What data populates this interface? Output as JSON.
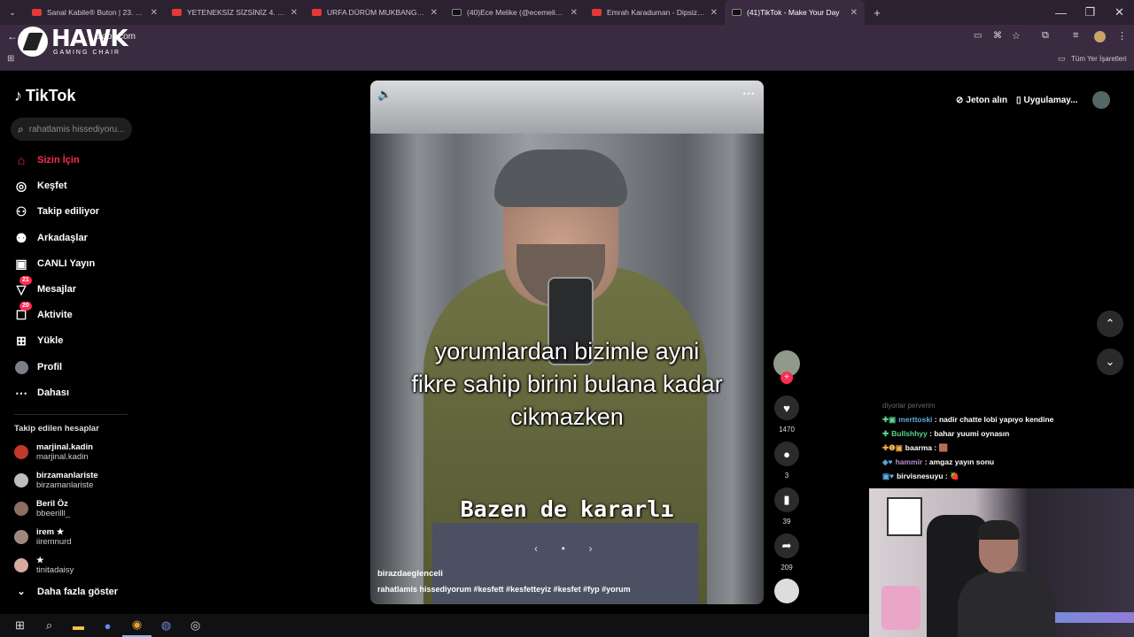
{
  "browser": {
    "tabs": [
      {
        "title": "Sanal Kabile® Buton | 23. Bölüm",
        "icon": "youtube-icon"
      },
      {
        "title": "YETENEKSİZ SİZSİNİZ 4. BÖLÜM",
        "icon": "youtube-icon"
      },
      {
        "title": "URFA DÜRÜM MUKBANG İLİŞK",
        "icon": "youtube-icon"
      },
      {
        "title": "(40)Ece Melike (@ecemelikec) |",
        "icon": "tiktok-icon"
      },
      {
        "title": "Emrah Karaduman - Dipsiz Kuyu",
        "icon": "youtube-icon"
      },
      {
        "title": "(41)TikTok - Make Your Day",
        "icon": "tiktok-icon"
      }
    ],
    "url": "tiktok.com",
    "bookmarks_label": "Tüm Yer İşaretleri"
  },
  "overlay_logo": {
    "word": "HAWK",
    "sub": "GAMING CHAIR"
  },
  "tiktok": {
    "logo": "TikTok",
    "search_placeholder": "rahatlamis hissediyoru...",
    "nav": [
      {
        "label": "Sizin İçin",
        "icon": "home-icon",
        "active": true
      },
      {
        "label": "Keşfet",
        "icon": "compass-icon"
      },
      {
        "label": "Takip ediliyor",
        "icon": "user-follow-icon"
      },
      {
        "label": "Arkadaşlar",
        "icon": "friends-icon"
      },
      {
        "label": "CANLI Yayın",
        "icon": "live-tv-icon"
      },
      {
        "label": "Mesajlar",
        "icon": "message-icon",
        "badge": "21"
      },
      {
        "label": "Aktivite",
        "icon": "activity-icon",
        "badge": "20"
      },
      {
        "label": "Yükle",
        "icon": "upload-icon"
      },
      {
        "label": "Profil",
        "icon": "profile-avatar"
      },
      {
        "label": "Dahası",
        "icon": "more-dots-icon"
      }
    ],
    "following_title": "Takip edilen hesaplar",
    "following": [
      {
        "name": "marjinal.kadin",
        "handle": "marjinal.kadin",
        "color": "#c0392b"
      },
      {
        "name": "birzamanlariste",
        "handle": "birzamanlariste",
        "color": "#bdbdbd"
      },
      {
        "name": "Beril Öz",
        "handle": "bbeerilll_",
        "color": "#8d6e63"
      },
      {
        "name": "irem ★",
        "handle": "iiremnurd",
        "color": "#a1887f"
      },
      {
        "name": "★",
        "handle": "tinitadaisy",
        "color": "#d7a9a0"
      }
    ],
    "show_more": "Daha fazla göster",
    "top_right": {
      "coins": "Jeton alın",
      "app": "Uygulamay..."
    },
    "video": {
      "caption_lines": [
        "yorumlardan bizimle ayni",
        "fikre sahip birini bulana kadar",
        "cikmazken"
      ],
      "caption_bottom": "Bazen de kararlı",
      "author": "birazdaeglenceli",
      "description": "rahatlamis hissediyorum #kesfett #kesfetteyiz #kesfet #fyp #yorum"
    },
    "actions": {
      "likes": "1470",
      "comments": "3",
      "saves": "39",
      "shares": "209"
    }
  },
  "stream_chat": {
    "header": "diyorlar perverim",
    "messages": [
      {
        "user": "merttoski",
        "user_color": "#5dade2",
        "text": ": nadir chatte lobi yapıyo kendine",
        "badges": "✚▣"
      },
      {
        "user": "Bullshhyy",
        "user_color": "#58d68d",
        "text": ": bahar yuumi oynasın",
        "badges": "✚"
      },
      {
        "user": "baarma",
        "user_color": "#ffffff",
        "text": ": 🟫",
        "badges": "✚❶▣"
      },
      {
        "user": "hammir",
        "user_color": "#bb8fce",
        "text": ": amgaz yayın sonu",
        "badges": "◈♥"
      },
      {
        "user": "birvisnesuyu",
        "user_color": "#ffffff",
        "text": ": 🍓",
        "badges": "▣♥"
      }
    ]
  }
}
